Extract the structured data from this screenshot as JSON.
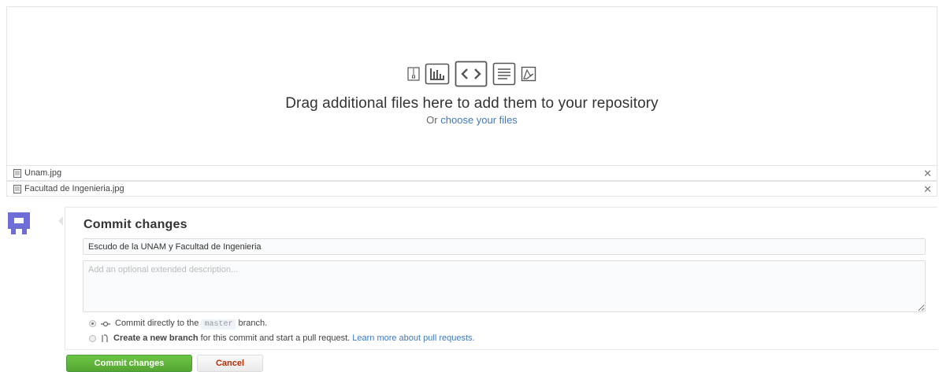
{
  "upload": {
    "title": "Drag additional files here to add them to your repository",
    "or_text": "Or",
    "choose_link": "choose your files",
    "icons": [
      "file-zip-icon",
      "chart-file-icon",
      "code-file-icon",
      "text-file-icon",
      "pdf-file-icon"
    ]
  },
  "files": [
    {
      "name": "Unam.jpg",
      "remove": "✕"
    },
    {
      "name": "Facultad de Ingenieria.jpg",
      "remove": "✕"
    }
  ],
  "commit": {
    "heading": "Commit changes",
    "summary_value": "Escudo de la UNAM y Facultad de Ingenieria",
    "description_placeholder": "Add an optional extended description...",
    "option_direct_prefix": "Commit directly to the",
    "branch_name": "master",
    "option_direct_suffix": "branch.",
    "option_new_bold": "Create a new branch",
    "option_new_text": "for this commit and start a pull request.",
    "learn_more_link": "Learn more about pull requests.",
    "commit_button": "Commit changes",
    "cancel_button": "Cancel"
  },
  "colors": {
    "accent_link": "#4078c0",
    "commit_green": "#55a532",
    "cancel_red": "#bd2c00",
    "avatar": "#6e6ed6"
  }
}
